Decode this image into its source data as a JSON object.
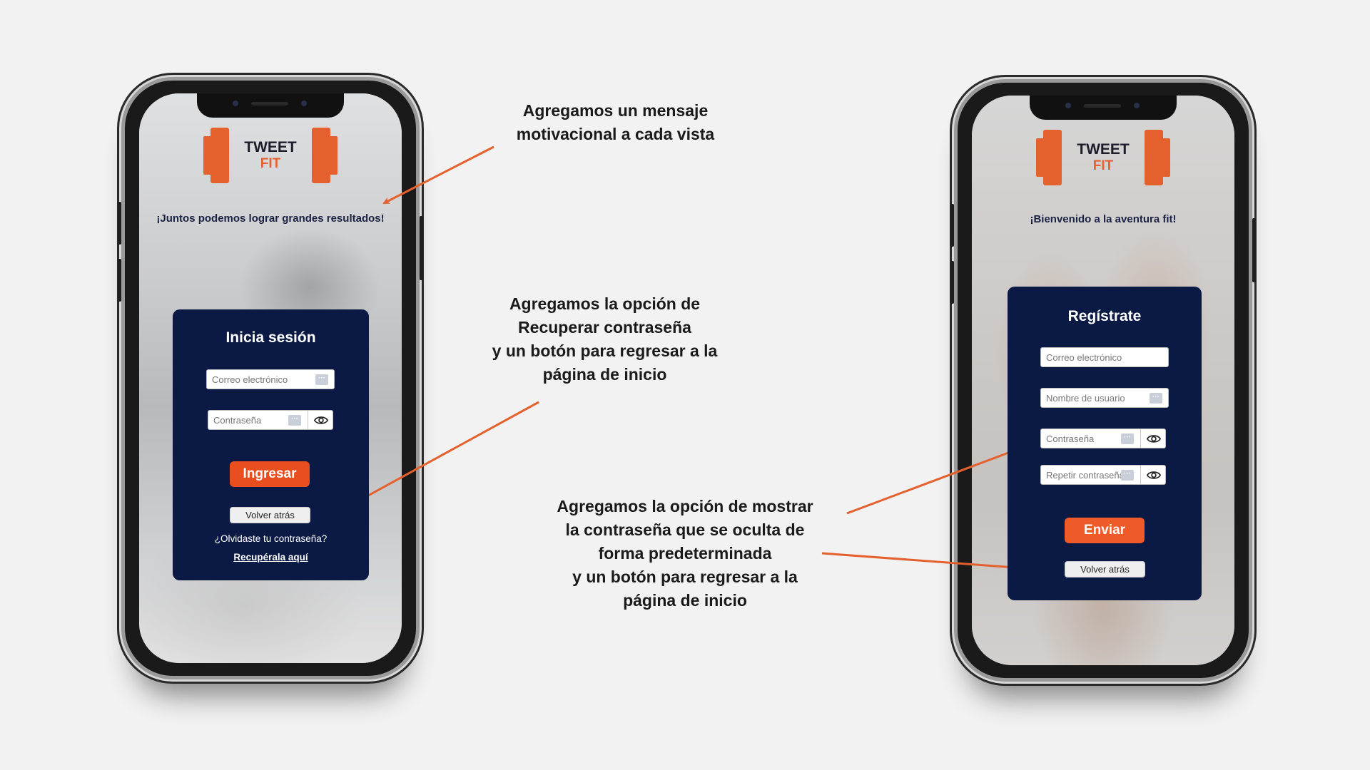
{
  "colors": {
    "accent_orange": "#e4612e",
    "card_navy": "#0b1945",
    "button_red": "#e94e1f",
    "arrow": "#e4612e",
    "background": "#f2f2f2"
  },
  "login_screen": {
    "logo": {
      "line1": "TWEET",
      "line2": "FIT"
    },
    "motto": "¡Juntos podemos lograr grandes resultados!",
    "card": {
      "title": "Inicia sesión",
      "email_placeholder": "Correo electrónico",
      "password_placeholder": "Contraseña",
      "submit_label": "Ingresar",
      "back_label": "Volver atrás",
      "forgot_text": "¿Olvidaste tu contraseña?",
      "recover_link": "Recupérala aquí"
    },
    "icons": {
      "dots": "password-manager-icon",
      "eye": "eye-icon"
    }
  },
  "register_screen": {
    "logo": {
      "line1": "TWEET",
      "line2": "FIT"
    },
    "motto": "¡Bienvenido a la aventura fit!",
    "card": {
      "title": "Regístrate",
      "email_placeholder": "Correo electrónico",
      "username_placeholder": "Nombre de usuario",
      "password_placeholder": "Contraseña",
      "repeat_password_placeholder": "Repetir contraseña",
      "submit_label": "Enviar",
      "back_label": "Volver atrás"
    }
  },
  "annotations": {
    "motivational": "Agregamos un mensaje\nmotivacional a cada vista",
    "recover": "Agregamos la opción de\nRecuperar  contraseña\ny un botón para regresar a la\npágina de inicio",
    "show_password": "Agregamos la opción de mostrar\nla contraseña que se oculta de\nforma predeterminada\ny un botón para regresar a la\npágina de inicio"
  }
}
